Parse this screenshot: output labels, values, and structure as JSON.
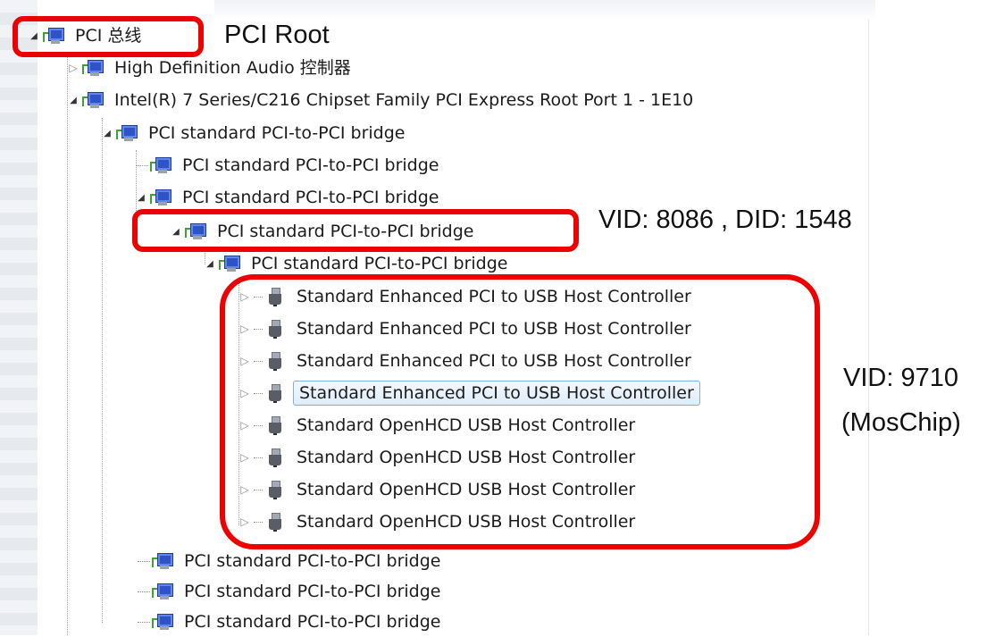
{
  "tree": {
    "root": {
      "label": "PCI 总线"
    },
    "hd_audio": {
      "label": "High Definition Audio 控制器"
    },
    "root_port": {
      "label": "Intel(R) 7 Series/C216 Chipset Family PCI Express Root Port 1 - 1E10"
    },
    "bridge_1": {
      "label": "PCI standard PCI-to-PCI bridge"
    },
    "bridge_2": {
      "label": "PCI standard PCI-to-PCI bridge"
    },
    "bridge_3": {
      "label": "PCI standard PCI-to-PCI bridge"
    },
    "bridge_4": {
      "label": "PCI standard PCI-to-PCI bridge"
    },
    "bridge_5": {
      "label": "PCI standard PCI-to-PCI bridge"
    },
    "usb_controllers": [
      {
        "label": "Standard Enhanced PCI to USB Host Controller"
      },
      {
        "label": "Standard Enhanced PCI to USB Host Controller"
      },
      {
        "label": "Standard Enhanced PCI to USB Host Controller"
      },
      {
        "label": "Standard Enhanced PCI to USB Host Controller"
      },
      {
        "label": "Standard OpenHCD USB Host Controller"
      },
      {
        "label": "Standard OpenHCD USB Host Controller"
      },
      {
        "label": "Standard OpenHCD USB Host Controller"
      },
      {
        "label": "Standard OpenHCD USB Host Controller"
      }
    ],
    "bridges_tail": [
      {
        "label": "PCI standard PCI-to-PCI bridge"
      },
      {
        "label": "PCI standard PCI-to-PCI bridge"
      },
      {
        "label": "PCI standard PCI-to-PCI bridge"
      }
    ],
    "selected_usb_index": 3
  },
  "annotations": {
    "root": "PCI Root",
    "bridge": "VID: 8086 , DID: 1548",
    "usb_line1": "VID: 9710",
    "usb_line2": "(MosChip)"
  },
  "colors": {
    "annotation_red": "#ee0000",
    "selection_border": "#84acdd"
  }
}
